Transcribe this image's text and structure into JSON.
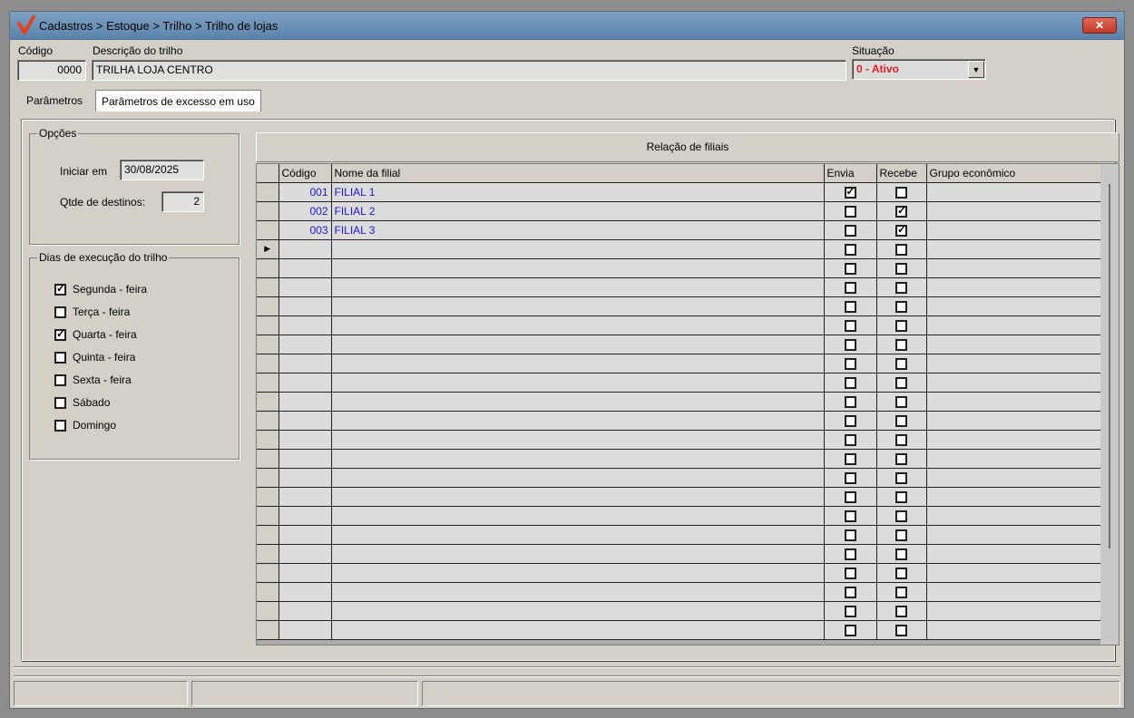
{
  "window": {
    "title": "Cadastros > Estoque > Trilho > Trilho de lojas",
    "close_label": "✕"
  },
  "header": {
    "codigo_label": "Código",
    "codigo_value": "0000",
    "descricao_label": "Descrição do trilho",
    "descricao_value": "TRILHA LOJA CENTRO",
    "situacao_label": "Situação",
    "situacao_value": "0 - Ativo"
  },
  "tabs": [
    {
      "label": "Parâmetros",
      "active": true
    },
    {
      "label": "Parâmetros de excesso em uso",
      "active": false
    }
  ],
  "opcoes": {
    "legend": "Opções",
    "iniciar_label": "Iniciar em",
    "iniciar_value": "30/08/2025",
    "qtde_label": "Qtde de destinos:",
    "qtde_value": "2"
  },
  "dias": {
    "legend": "Dias de execução do trilho",
    "items": [
      {
        "label": "Segunda - feira",
        "checked": true
      },
      {
        "label": "Terça - feira",
        "checked": false
      },
      {
        "label": "Quarta - feira",
        "checked": true
      },
      {
        "label": "Quinta - feira",
        "checked": false
      },
      {
        "label": "Sexta - feira",
        "checked": false
      },
      {
        "label": "Sábado",
        "checked": false
      },
      {
        "label": "Domingo",
        "checked": false
      }
    ]
  },
  "grid": {
    "title": "Relação de filiais",
    "columns": [
      "Código",
      "Nome da filial",
      "Envia",
      "Recebe",
      "Grupo econômico"
    ],
    "rows": [
      {
        "codigo": "001",
        "nome": "FILIAL 1",
        "envia": true,
        "recebe": false,
        "grupo": ""
      },
      {
        "codigo": "002",
        "nome": "FILIAL 2",
        "envia": false,
        "recebe": true,
        "grupo": ""
      },
      {
        "codigo": "003",
        "nome": "FILIAL 3",
        "envia": false,
        "recebe": true,
        "grupo": ""
      }
    ],
    "current_row_marker": "▶",
    "current_row_index": 3,
    "empty_rows": 21
  }
}
